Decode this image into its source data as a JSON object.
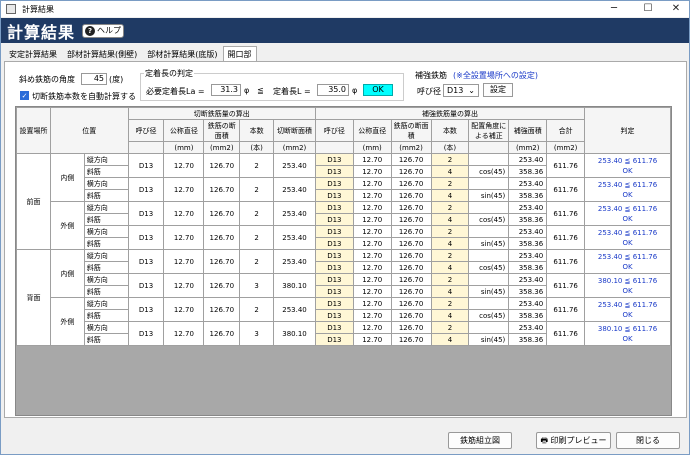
{
  "window": {
    "title": "計算結果"
  },
  "header": {
    "title": "計算結果",
    "help_label": "ヘルプ"
  },
  "tabs": [
    "安定計算結果",
    "部材計算結果(側壁)",
    "部材計算結果(底版)",
    "開口部"
  ],
  "form": {
    "angle_label": "斜め鉄筋の角度",
    "angle_value": "45",
    "angle_unit": "(度)",
    "auto_label": "切断鉄筋本数を自動計算する",
    "anchor_group": "定着長の判定",
    "required_label": "必要定着長La =",
    "required_value": "31.3",
    "phi1": "φ",
    "le": "≦",
    "anchor_label": "定着長L =",
    "anchor_value": "35.0",
    "phi2": "φ",
    "ok": "OK",
    "reinf_group": "補強鉄筋",
    "reinf_note": "(※全設置場所への設定)",
    "name_label": "呼び径",
    "name_value": "D13",
    "set_button": "設定"
  },
  "table": {
    "h_place": "設置場所",
    "h_pos": "位置",
    "h_cut": "切断鉄筋量の算出",
    "h_reinf": "補強鉄筋量の算出",
    "h_judge": "判定",
    "cols": [
      "呼び径",
      "公称直径",
      "鉄筋の断面積",
      "本数",
      "切断断面積",
      "呼び径",
      "公称直径",
      "鉄筋の断面積",
      "本数",
      "配置角度による補正",
      "補強面積",
      "合計"
    ],
    "units": [
      "",
      "(mm)",
      "(mm2)",
      "(本)",
      "(mm2)",
      "",
      "(mm)",
      "(mm2)",
      "(本)",
      "",
      "(mm2)",
      "(mm2)"
    ],
    "groups": [
      {
        "place": "前面",
        "subs": [
          {
            "pos": "内側",
            "rows": [
              {
                "a": "縦方向",
                "b": "斜筋",
                "c": [
                  "D13",
                  "12.70",
                  "126.70",
                  "2",
                  "253.40"
                ],
                "d": [
                  [
                    "D13",
                    "12.70",
                    "126.70",
                    "2",
                    "",
                    "253.40"
                  ],
                  [
                    "D13",
                    "12.70",
                    "126.70",
                    "4",
                    "cos(45)",
                    "358.36"
                  ]
                ],
                "total": "611.76",
                "j1": "253.40 ≦ 611.76",
                "j2": "OK"
              },
              {
                "a": "横方向",
                "b": "斜筋",
                "c": [
                  "D13",
                  "12.70",
                  "126.70",
                  "2",
                  "253.40"
                ],
                "d": [
                  [
                    "D13",
                    "12.70",
                    "126.70",
                    "2",
                    "",
                    "253.40"
                  ],
                  [
                    "D13",
                    "12.70",
                    "126.70",
                    "4",
                    "sin(45)",
                    "358.36"
                  ]
                ],
                "total": "611.76",
                "j1": "253.40 ≦ 611.76",
                "j2": "OK"
              }
            ]
          },
          {
            "pos": "外側",
            "rows": [
              {
                "a": "縦方向",
                "b": "斜筋",
                "c": [
                  "D13",
                  "12.70",
                  "126.70",
                  "2",
                  "253.40"
                ],
                "d": [
                  [
                    "D13",
                    "12.70",
                    "126.70",
                    "2",
                    "",
                    "253.40"
                  ],
                  [
                    "D13",
                    "12.70",
                    "126.70",
                    "4",
                    "cos(45)",
                    "358.36"
                  ]
                ],
                "total": "611.76",
                "j1": "253.40 ≦ 611.76",
                "j2": "OK"
              },
              {
                "a": "横方向",
                "b": "斜筋",
                "c": [
                  "D13",
                  "12.70",
                  "126.70",
                  "2",
                  "253.40"
                ],
                "d": [
                  [
                    "D13",
                    "12.70",
                    "126.70",
                    "2",
                    "",
                    "253.40"
                  ],
                  [
                    "D13",
                    "12.70",
                    "126.70",
                    "4",
                    "sin(45)",
                    "358.36"
                  ]
                ],
                "total": "611.76",
                "j1": "253.40 ≦ 611.76",
                "j2": "OK"
              }
            ]
          }
        ]
      },
      {
        "place": "背面",
        "subs": [
          {
            "pos": "内側",
            "rows": [
              {
                "a": "縦方向",
                "b": "斜筋",
                "c": [
                  "D13",
                  "12.70",
                  "126.70",
                  "2",
                  "253.40"
                ],
                "d": [
                  [
                    "D13",
                    "12.70",
                    "126.70",
                    "2",
                    "",
                    "253.40"
                  ],
                  [
                    "D13",
                    "12.70",
                    "126.70",
                    "4",
                    "cos(45)",
                    "358.36"
                  ]
                ],
                "total": "611.76",
                "j1": "253.40 ≦ 611.76",
                "j2": "OK"
              },
              {
                "a": "横方向",
                "b": "斜筋",
                "c": [
                  "D13",
                  "12.70",
                  "126.70",
                  "3",
                  "380.10"
                ],
                "d": [
                  [
                    "D13",
                    "12.70",
                    "126.70",
                    "2",
                    "",
                    "253.40"
                  ],
                  [
                    "D13",
                    "12.70",
                    "126.70",
                    "4",
                    "sin(45)",
                    "358.36"
                  ]
                ],
                "total": "611.76",
                "j1": "380.10 ≦ 611.76",
                "j2": "OK"
              }
            ]
          },
          {
            "pos": "外側",
            "rows": [
              {
                "a": "縦方向",
                "b": "斜筋",
                "c": [
                  "D13",
                  "12.70",
                  "126.70",
                  "2",
                  "253.40"
                ],
                "d": [
                  [
                    "D13",
                    "12.70",
                    "126.70",
                    "2",
                    "",
                    "253.40"
                  ],
                  [
                    "D13",
                    "12.70",
                    "126.70",
                    "4",
                    "cos(45)",
                    "358.36"
                  ]
                ],
                "total": "611.76",
                "j1": "253.40 ≦ 611.76",
                "j2": "OK"
              },
              {
                "a": "横方向",
                "b": "斜筋",
                "c": [
                  "D13",
                  "12.70",
                  "126.70",
                  "3",
                  "380.10"
                ],
                "d": [
                  [
                    "D13",
                    "12.70",
                    "126.70",
                    "2",
                    "",
                    "253.40"
                  ],
                  [
                    "D13",
                    "12.70",
                    "126.70",
                    "4",
                    "sin(45)",
                    "358.36"
                  ]
                ],
                "total": "611.76",
                "j1": "380.10 ≦ 611.76",
                "j2": "OK"
              }
            ]
          }
        ]
      }
    ]
  },
  "buttons": {
    "assembly": "鉄筋組立図",
    "preview": "印刷プレビュー",
    "close": "閉じる"
  }
}
